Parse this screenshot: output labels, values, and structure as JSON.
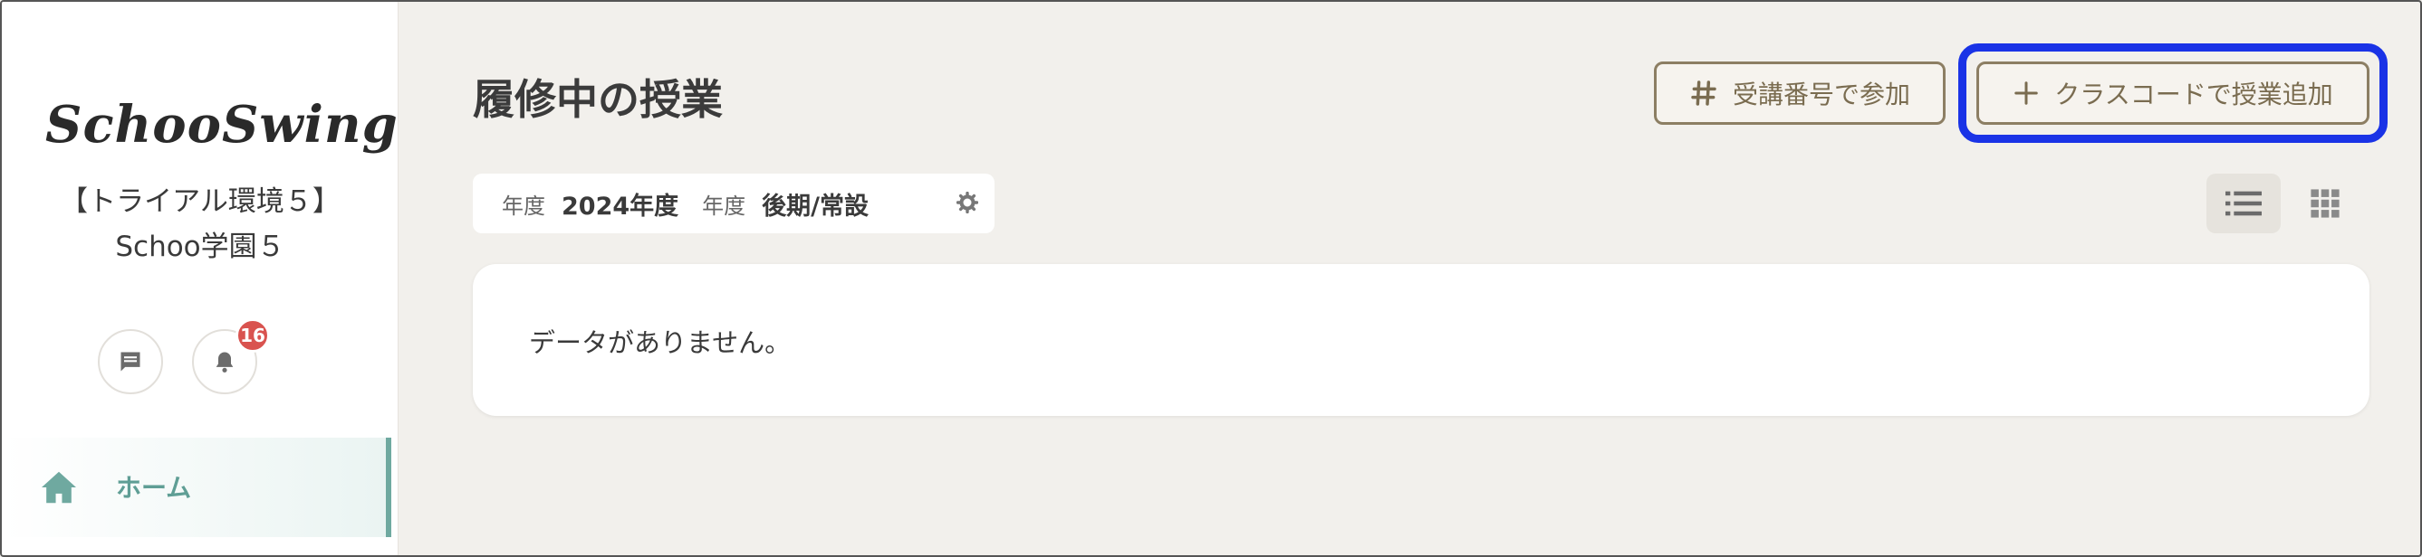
{
  "sidebar": {
    "logo_text": "SchooSwing",
    "org_name": "【トライアル環境５】Schoo学園５",
    "notifications_badge": "16",
    "nav": [
      {
        "label": "ホーム",
        "icon": "home-icon",
        "active": true
      }
    ]
  },
  "main": {
    "page_title": "履修中の授業",
    "buttons": {
      "join_label": "受講番号で参加",
      "add_label": "クラスコードで授業追加"
    },
    "filter": {
      "year_label": "年度",
      "year_value": "2024年度",
      "term_label": "年度",
      "term_value": "後期/常設"
    },
    "empty_message": "データがありません。"
  },
  "colors": {
    "accent_teal": "#5f9e95",
    "button_border": "#8c7e63",
    "highlight": "#1a33e6",
    "badge": "#d9534f",
    "background": "#f2f0ec"
  }
}
